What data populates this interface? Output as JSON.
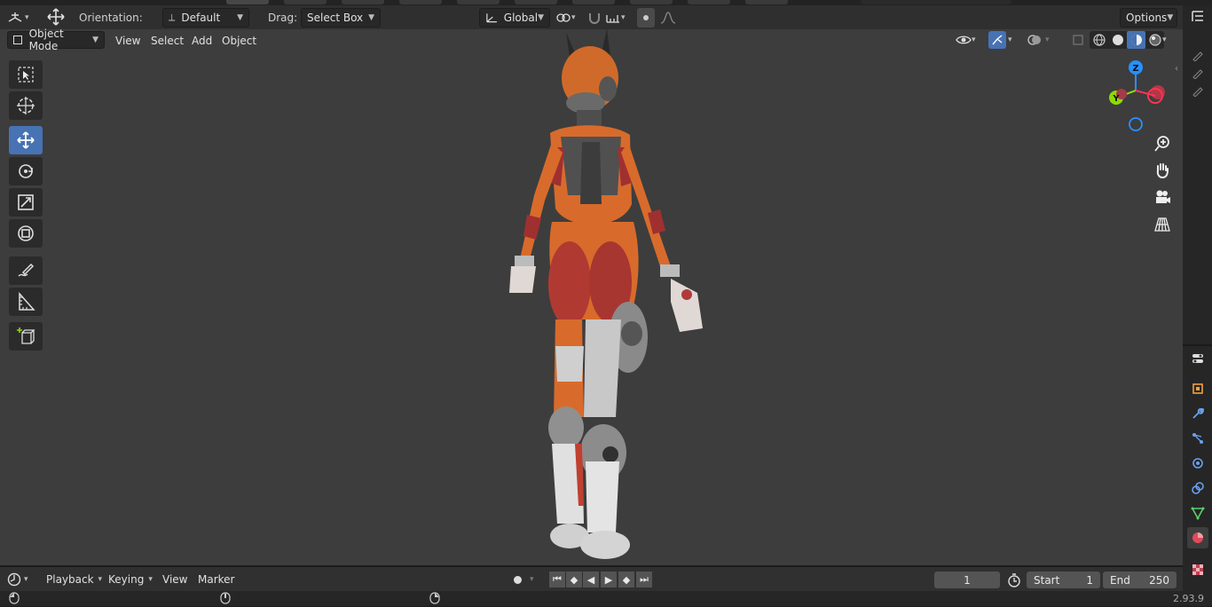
{
  "tool_header": {
    "orientation_label": "Orientation:",
    "orientation_value": "Default",
    "drag_label": "Drag:",
    "drag_value": "Select Box",
    "transform_orientation": "Global",
    "options_label": "Options"
  },
  "view_header": {
    "mode": "Object Mode",
    "menus": [
      "View",
      "Select",
      "Add",
      "Object"
    ]
  },
  "left_toolbar": {
    "tools": [
      "select-box",
      "cursor",
      "move",
      "rotate",
      "scale",
      "transform",
      "annotate",
      "measure",
      "add-cube"
    ],
    "active": "move"
  },
  "gizmo": {
    "z_label": "Z",
    "y_label": "Y",
    "colors": {
      "x": "#ff3352",
      "y": "#8bdc00",
      "z": "#2890ff"
    }
  },
  "timeline": {
    "menus": [
      "Playback",
      "Keying",
      "View",
      "Marker"
    ],
    "current_frame": "1",
    "start_label": "Start",
    "start_value": "1",
    "end_label": "End",
    "end_value": "250"
  },
  "status": {
    "version": "2.93.9"
  },
  "colors": {
    "active_tool": "#4772b3",
    "viewport_bg": "#3d3d3d"
  }
}
